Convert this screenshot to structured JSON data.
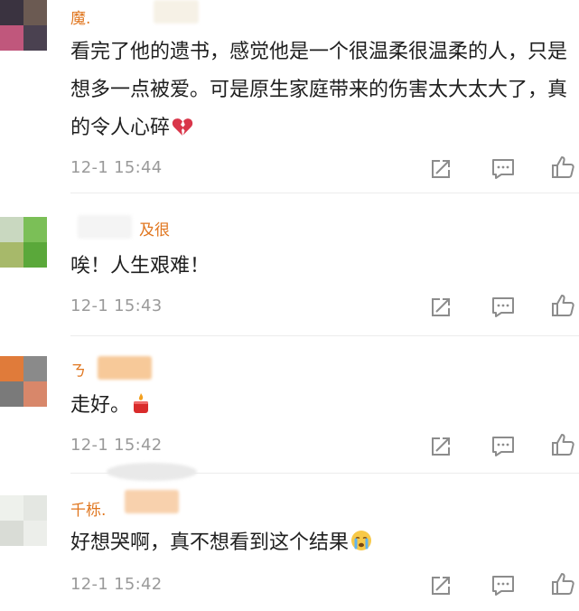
{
  "comments": [
    {
      "username": "魔.",
      "text": "看完了他的遗书，感觉他是一个很温柔很温柔的人，只是想多一点被爱。可是原生家庭带来的伤害太大太大了，真的令人心碎",
      "emoji": "broken-heart-icon",
      "time": "12-1 15:44"
    },
    {
      "username": "及很",
      "text": "唉！人生艰难！",
      "time": "12-1 15:43"
    },
    {
      "username": "ㄋ",
      "text": "走好。",
      "emoji": "candle-icon",
      "time": "12-1 15:42"
    },
    {
      "username": "千栎.",
      "text": "好想哭啊，真不想看到这个结果",
      "emoji": "crying-face-icon",
      "time": "12-1 15:42"
    }
  ],
  "colors": {
    "username": "#e0761f",
    "text": "#1f1f1f",
    "timestamp": "#9a9a9a",
    "icon": "#8c8c8c"
  }
}
